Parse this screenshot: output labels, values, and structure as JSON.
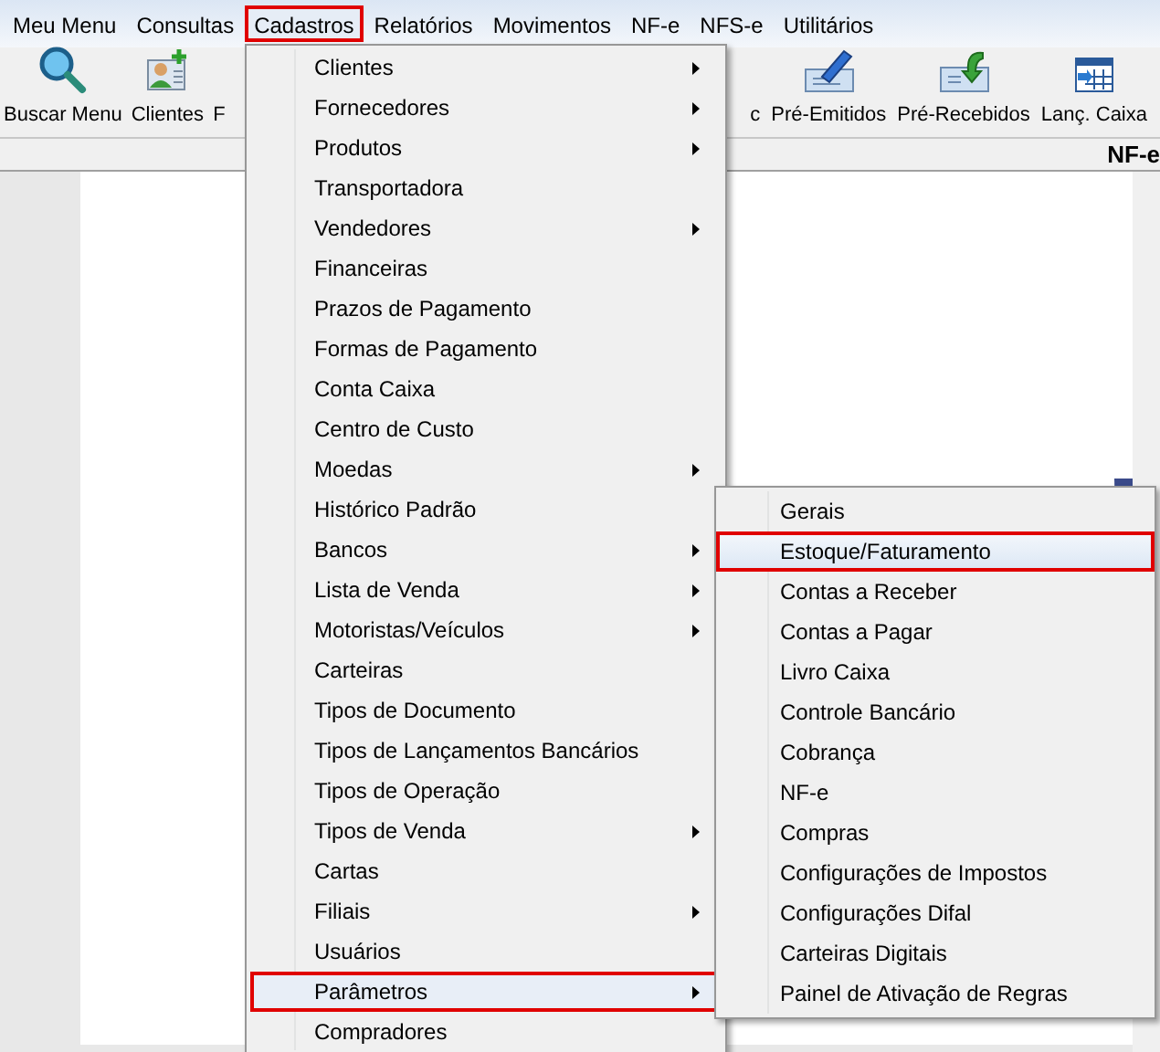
{
  "menu_bar": [
    {
      "label": "Meu Menu",
      "selected": false
    },
    {
      "label": "Consultas",
      "selected": false
    },
    {
      "label": "Cadastros",
      "selected": true
    },
    {
      "label": "Relatórios",
      "selected": false
    },
    {
      "label": "Movimentos",
      "selected": false
    },
    {
      "label": "NF-e",
      "selected": false
    },
    {
      "label": "NFS-e",
      "selected": false
    },
    {
      "label": "Utilitários",
      "selected": false
    }
  ],
  "toolbar_left": [
    {
      "label": "Buscar Menu",
      "kind": "search"
    },
    {
      "label": "Clientes",
      "kind": "client"
    },
    {
      "label": "F",
      "kind": "none"
    }
  ],
  "toolbar_right": [
    {
      "label": "c",
      "kind": "none"
    },
    {
      "label": "Pré-Emitidos",
      "kind": "pen"
    },
    {
      "label": "Pré-Recebidos",
      "kind": "receive"
    },
    {
      "label": "Lanç. Caixa",
      "kind": "calendar"
    }
  ],
  "strip_title": "NF-e",
  "dropdown": [
    {
      "label": "Clientes",
      "submenu": true,
      "selected": false
    },
    {
      "label": "Fornecedores",
      "submenu": true,
      "selected": false
    },
    {
      "label": "Produtos",
      "submenu": true,
      "selected": false
    },
    {
      "label": "Transportadora",
      "submenu": false,
      "selected": false
    },
    {
      "label": "Vendedores",
      "submenu": true,
      "selected": false
    },
    {
      "label": "Financeiras",
      "submenu": false,
      "selected": false
    },
    {
      "label": "Prazos de Pagamento",
      "submenu": false,
      "selected": false
    },
    {
      "label": "Formas de Pagamento",
      "submenu": false,
      "selected": false
    },
    {
      "label": "Conta Caixa",
      "submenu": false,
      "selected": false
    },
    {
      "label": "Centro de Custo",
      "submenu": false,
      "selected": false
    },
    {
      "label": "Moedas",
      "submenu": true,
      "selected": false
    },
    {
      "label": "Histórico Padrão",
      "submenu": false,
      "selected": false
    },
    {
      "label": "Bancos",
      "submenu": true,
      "selected": false
    },
    {
      "label": "Lista de Venda",
      "submenu": true,
      "selected": false
    },
    {
      "label": "Motoristas/Veículos",
      "submenu": true,
      "selected": false
    },
    {
      "label": "Carteiras",
      "submenu": false,
      "selected": false
    },
    {
      "label": "Tipos de Documento",
      "submenu": false,
      "selected": false
    },
    {
      "label": "Tipos de Lançamentos Bancários",
      "submenu": false,
      "selected": false
    },
    {
      "label": "Tipos de Operação",
      "submenu": false,
      "selected": false
    },
    {
      "label": "Tipos de Venda",
      "submenu": true,
      "selected": false
    },
    {
      "label": "Cartas",
      "submenu": false,
      "selected": false
    },
    {
      "label": "Filiais",
      "submenu": true,
      "selected": false
    },
    {
      "label": "Usuários",
      "submenu": false,
      "selected": false
    },
    {
      "label": "Parâmetros",
      "submenu": true,
      "selected": true
    },
    {
      "label": "Compradores",
      "submenu": false,
      "selected": false
    }
  ],
  "submenu": [
    {
      "label": "Gerais",
      "selected": false
    },
    {
      "label": "Estoque/Faturamento",
      "selected": true
    },
    {
      "label": "Contas a Receber",
      "selected": false
    },
    {
      "label": "Contas a Pagar",
      "selected": false
    },
    {
      "label": "Livro Caixa",
      "selected": false
    },
    {
      "label": "Controle Bancário",
      "selected": false
    },
    {
      "label": "Cobrança",
      "selected": false
    },
    {
      "label": "NF-e",
      "selected": false
    },
    {
      "label": "Compras",
      "selected": false
    },
    {
      "label": "Configurações de Impostos",
      "selected": false
    },
    {
      "label": "Configurações Difal",
      "selected": false
    },
    {
      "label": "Carteiras Digitais",
      "selected": false
    },
    {
      "label": "Painel de Ativação de Regras",
      "selected": false
    }
  ]
}
